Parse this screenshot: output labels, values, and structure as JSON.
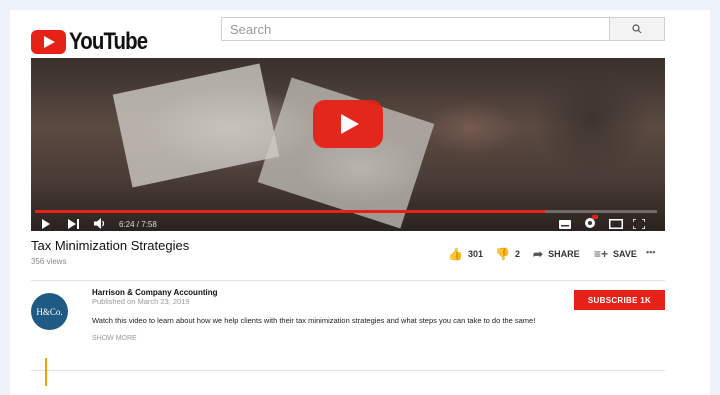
{
  "header": {
    "logo_text": "YouTube",
    "search_placeholder": "Search"
  },
  "player": {
    "current_time": "6:24 / 7:58",
    "progress_fraction": 0.82
  },
  "video": {
    "title": "Tax Minimization Strategies",
    "views": "356 views",
    "likes": "301",
    "dislikes": "2",
    "share_label": "SHARE",
    "save_label": "SAVE",
    "more": "•••"
  },
  "channel": {
    "avatar_text": "H&Co.",
    "name": "Harrison & Company Accounting",
    "published": "Published on March 23, 2019",
    "description": "Watch this video to learn about how we help clients with their tax minimization strategies and what steps you can take to do the same!",
    "show_more": "SHOW MORE",
    "subscribe_label": "SUBSCRIBE 1K"
  },
  "colors": {
    "brand_red": "#e62117",
    "avatar_blue": "#1f5a85",
    "accent_orange": "#f5a000"
  },
  "icons": [
    "youtube-logo-icon",
    "search-icon",
    "big-play-icon",
    "play-icon",
    "next-icon",
    "volume-icon",
    "subtitles-icon",
    "settings-icon",
    "theater-icon",
    "fullscreen-icon",
    "thumbs-up-icon",
    "thumbs-down-icon",
    "share-icon",
    "save-icon",
    "more-icon"
  ]
}
